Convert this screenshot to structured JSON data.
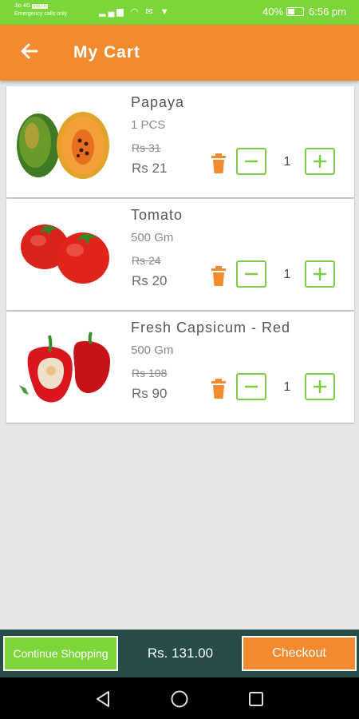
{
  "status_bar": {
    "carrier": "Jio 4G",
    "carrier_badge": "VoLTE",
    "emergency": "Emergency calls only",
    "battery": "40%",
    "time": "6:56 pm"
  },
  "header": {
    "title": "My Cart",
    "back_icon": "arrow-left-icon"
  },
  "cart": {
    "items": [
      {
        "name": "Papaya",
        "unit": "1 PCS",
        "old_price": "Rs 31",
        "price": "Rs 21",
        "qty": "1"
      },
      {
        "name": "Tomato",
        "unit": "500 Gm",
        "old_price": "Rs 24",
        "price": "Rs 20",
        "qty": "1"
      },
      {
        "name": "Fresh Capsicum - Red",
        "unit": "500 Gm",
        "old_price": "Rs 108",
        "price": "Rs 90",
        "qty": "1"
      }
    ]
  },
  "bottom_bar": {
    "continue_label": "Continue Shopping",
    "total": "Rs. 131.00",
    "checkout_label": "Checkout"
  },
  "colors": {
    "status_green": "#7cd63a",
    "header_orange": "#f28a30",
    "qty_border_green": "#7ccc45",
    "bottom_bar": "#274b49",
    "background": "#e6e6e6"
  },
  "icons": [
    "arrow-left-icon",
    "trash-icon",
    "minus-icon",
    "plus-icon",
    "nav-back-icon",
    "nav-home-icon",
    "nav-recents-icon"
  ]
}
